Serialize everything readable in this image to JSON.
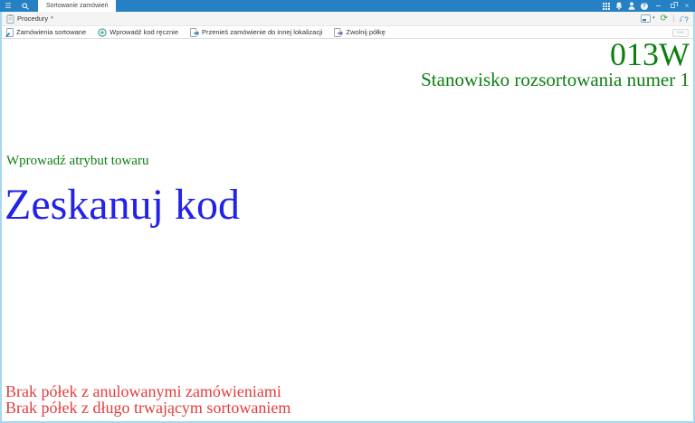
{
  "icons": {
    "hamburger": "☰",
    "close": "×",
    "chevron_down": "▾",
    "refresh": "⟳",
    "ellipsis": "⋯",
    "question": "?"
  },
  "window": {
    "tab": "Sortowanie zamówień"
  },
  "toolbar": {
    "menu": "Procedury"
  },
  "actions": [
    {
      "label": "Zamówienia sortowane",
      "icon": "sorted-orders-icon"
    },
    {
      "label": "Wprowadź kod ręcznie",
      "icon": "manual-code-entry-icon"
    },
    {
      "label": "Przenieś zamówienie do innej lokalizacji",
      "icon": "move-order-icon"
    },
    {
      "label": "Zwolnij półkę",
      "icon": "release-shelf-icon"
    }
  ],
  "main": {
    "station_code": "013W",
    "station_name": "Stanowisko rozsortowania numer 1",
    "attribute_prompt": "Wprowadź atrybut towaru",
    "scan_prompt": "Zeskanuj kod",
    "alerts": [
      "Brak półek z anulowanymi zamówieniami",
      "Brak półek z długo trwającym sortowaniem"
    ]
  },
  "colors": {
    "topbar_blue": "#2581c4",
    "window_border": "#a6d8f1",
    "station_green": "#0c7f10",
    "scan_blue": "#2323e8",
    "alert_red": "#e43c3c"
  }
}
